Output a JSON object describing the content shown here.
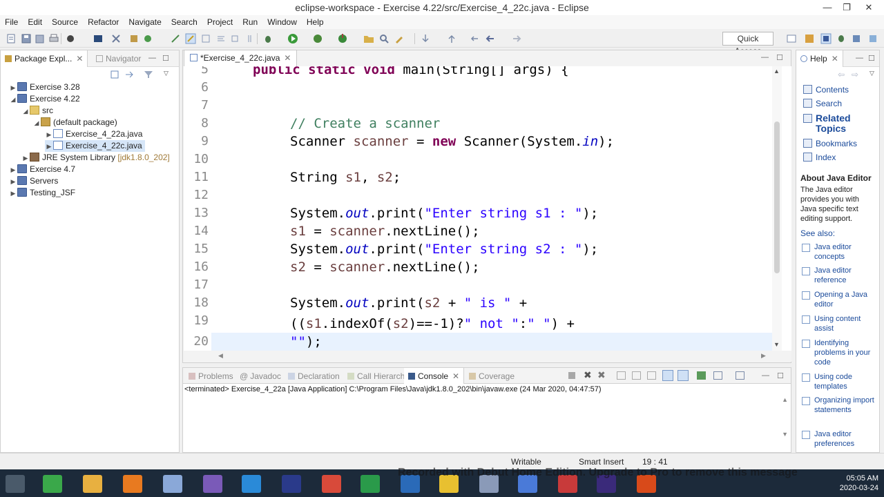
{
  "window": {
    "title": "eclipse-workspace - Exercise 4.22/src/Exercise_4_22c.java - Eclipse",
    "minimize": "—",
    "restore": "❐",
    "close": "✕"
  },
  "menu": [
    "File",
    "Edit",
    "Source",
    "Refactor",
    "Navigate",
    "Search",
    "Project",
    "Run",
    "Window",
    "Help"
  ],
  "toolbar": {
    "quick_access": "Quick Access"
  },
  "package_explorer": {
    "tab_label": "Package Expl...",
    "navigator_label": "Navigator",
    "tree": [
      {
        "label": "Exercise 3.28",
        "arrow": "▶"
      },
      {
        "label": "Exercise 4.22",
        "arrow": "◢"
      },
      {
        "label": "src",
        "arrow": "◢"
      },
      {
        "label": "(default package)",
        "arrow": "◢"
      },
      {
        "label": "Exercise_4_22a.java",
        "arrow": "▶"
      },
      {
        "label": "Exercise_4_22c.java",
        "arrow": "▶"
      },
      {
        "label": "JRE System Library",
        "suffix": "[jdk1.8.0_202]",
        "arrow": "▶"
      },
      {
        "label": "Exercise 4.7",
        "arrow": "▶"
      },
      {
        "label": "Servers",
        "arrow": "▶"
      },
      {
        "label": "Testing_JSF",
        "arrow": "▶"
      }
    ]
  },
  "editor": {
    "tab_label": "*Exercise_4_22c.java",
    "line_numbers": [
      "5",
      "6",
      "7",
      "8",
      "9",
      "10",
      "11",
      "12",
      "13",
      "14",
      "15",
      "16",
      "17",
      "18",
      "19",
      "20"
    ],
    "code": {
      "l5": {
        "kw": "public static void",
        "rest": " main(String[] args) {"
      },
      "l8": {
        "comment": "// Create a scanner"
      },
      "l9": {
        "a": "Scanner ",
        "var": "scanner",
        "b": " = ",
        "kw": "new",
        "c": " Scanner(System.",
        "fld": "in",
        "d": ");"
      },
      "l11": {
        "a": "String ",
        "var1": "s1",
        "b": ", ",
        "var2": "s2",
        "c": ";"
      },
      "l13": {
        "a": "System.",
        "fld": "out",
        "b": ".print(",
        "str": "\"Enter string s1 : \"",
        "c": ");"
      },
      "l14": {
        "var1": "s1",
        "a": " = ",
        "var2": "scanner",
        "b": ".nextLine();"
      },
      "l15": {
        "a": "System.",
        "fld": "out",
        "b": ".print(",
        "str": "\"Enter string s2 : \"",
        "c": ");"
      },
      "l16": {
        "var1": "s2",
        "a": " = ",
        "var2": "scanner",
        "b": ".nextLine();"
      },
      "l18": {
        "a": "System.",
        "fld": "out",
        "b": ".print(",
        "var": "s2",
        "c": " + ",
        "str": "\" is \"",
        "d": " +"
      },
      "l19": {
        "a": "((",
        "var1": "s1",
        "b": ".indexOf(",
        "var2": "s2",
        "c": ")==-1)?",
        "str1": "\" not \"",
        "d": ":",
        "str2": "\" \"",
        "e": ") +"
      },
      "l20": {
        "str": "\"\"",
        "a": ");"
      }
    }
  },
  "bottom_panel": {
    "tabs": [
      "Problems",
      "Javadoc",
      "Declaration",
      "Call Hierarchy",
      "Console",
      "Coverage"
    ],
    "active_tab": "Console",
    "terminated_text": "<terminated> Exercise_4_22a [Java Application] C:\\Program Files\\Java\\jdk1.8.0_202\\bin\\javaw.exe (24 Mar 2020, 04:47:57)"
  },
  "help": {
    "tab_label": "Help",
    "links": [
      "Contents",
      "Search",
      "Related Topics",
      "Bookmarks",
      "Index"
    ],
    "about_title": "About Java Editor",
    "about_body": "The Java editor provides you with Java specific text editing support.",
    "see_also": "See also:",
    "sub_links": [
      "Java editor concepts",
      "Java editor reference",
      "Opening a Java editor",
      "Using content assist",
      "Identifying problems in your code",
      "Using code templates",
      "Organizing import statements",
      "Java editor preferences"
    ]
  },
  "status": {
    "writable": "Writable",
    "insert_mode": "Smart Insert",
    "position": "19 : 41"
  },
  "taskbar": {
    "time": "05:05 AM",
    "date": "2020-03-24",
    "watermark": "Recorded with Debut Home Edition. Upgrade to Pro to remove this message"
  },
  "colors": {
    "keyword": "#7f0055",
    "comment": "#3f7f5f",
    "string": "#2a00ff",
    "field": "#0000c0",
    "local_var": "#6a3e3e"
  }
}
